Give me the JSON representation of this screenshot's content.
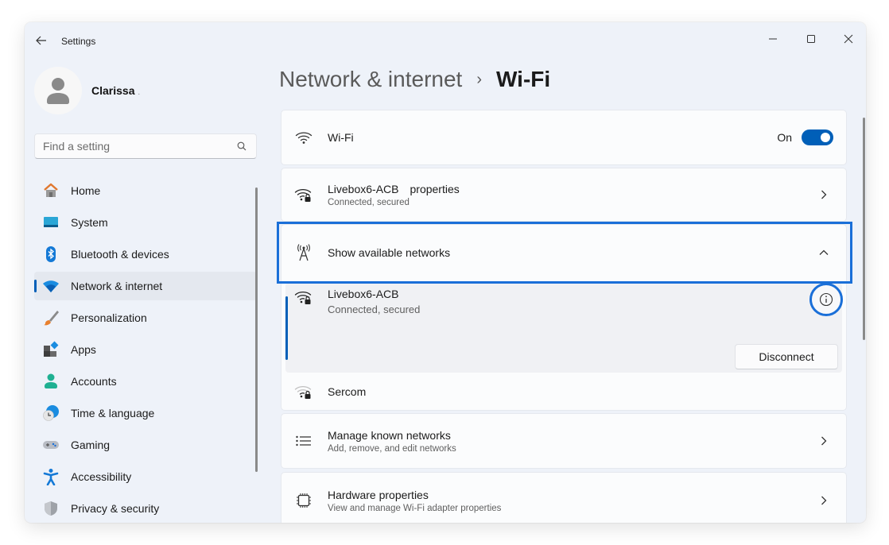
{
  "window": {
    "title": "Settings",
    "controls": {
      "minimize": "minimize",
      "maximize": "maximize",
      "close": "close"
    }
  },
  "profile": {
    "name": "Clarissa",
    "suffix": "."
  },
  "search": {
    "placeholder": "Find a setting",
    "value": ""
  },
  "sidebar": {
    "items": [
      {
        "label": "Home",
        "icon": "home-icon",
        "active": false
      },
      {
        "label": "System",
        "icon": "system-icon",
        "active": false
      },
      {
        "label": "Bluetooth & devices",
        "icon": "bluetooth-icon",
        "active": false
      },
      {
        "label": "Network & internet",
        "icon": "wifi-icon",
        "active": true
      },
      {
        "label": "Personalization",
        "icon": "brush-icon",
        "active": false
      },
      {
        "label": "Apps",
        "icon": "apps-icon",
        "active": false
      },
      {
        "label": "Accounts",
        "icon": "accounts-icon",
        "active": false
      },
      {
        "label": "Time & language",
        "icon": "time-language-icon",
        "active": false
      },
      {
        "label": "Gaming",
        "icon": "gamepad-icon",
        "active": false
      },
      {
        "label": "Accessibility",
        "icon": "accessibility-icon",
        "active": false
      },
      {
        "label": "Privacy & security",
        "icon": "shield-icon",
        "active": false
      }
    ]
  },
  "breadcrumb": {
    "parent": "Network & internet",
    "separator": "›",
    "current": "Wi-Fi"
  },
  "main": {
    "wifi": {
      "title": "Wi-Fi",
      "toggle_label": "On",
      "toggle_on": true
    },
    "properties": {
      "ssid": "Livebox6-ACB",
      "label": "properties",
      "status": "Connected, secured"
    },
    "available": {
      "title": "Show available networks",
      "expanded": true,
      "networks": [
        {
          "name": "Livebox6-ACB",
          "status": "Connected, secured",
          "action": "Disconnect"
        },
        {
          "name": "Sercom",
          "status": ""
        }
      ]
    },
    "manage": {
      "title": "Manage known networks",
      "subtitle": "Add, remove, and edit networks"
    },
    "hardware": {
      "title": "Hardware properties",
      "subtitle": "View and manage Wi-Fi adapter properties"
    }
  },
  "colors": {
    "accent": "#005fb8",
    "highlight": "#1a6fd8",
    "background": "#eef2f9",
    "card": "#fbfcfd"
  }
}
